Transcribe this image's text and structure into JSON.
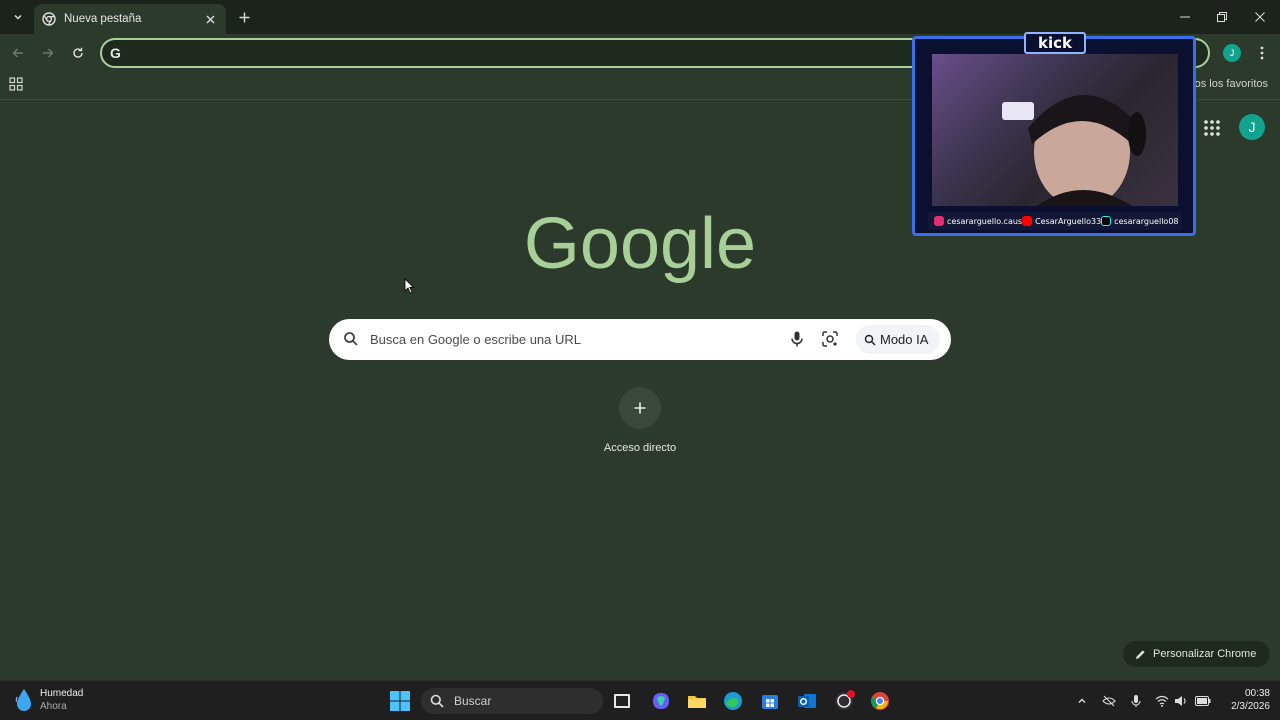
{
  "browser": {
    "tab": {
      "title": "Nueva pestaña"
    },
    "profile_initial": "J",
    "bookmarks": {
      "all_bookmarks_label": "dos los favoritos"
    }
  },
  "ntp": {
    "logo_text": "Google",
    "search_placeholder": "Busca en Google o escribe una URL",
    "ai_mode_label": "Modo IA",
    "shortcut_label": "Acceso directo",
    "customize_label": "Personalizar Chrome",
    "profile_initial": "J"
  },
  "overlay": {
    "brand": "kick",
    "socials": [
      {
        "handle": "cesararguello.caus",
        "color": "#e1306c"
      },
      {
        "handle": "CesarArguello33",
        "color": "#ff0000"
      },
      {
        "handle": "cesararguello08",
        "color": "#25f4ee"
      }
    ]
  },
  "taskbar": {
    "weather_title": "Humedad",
    "weather_sub": "Ahora",
    "search_label": "Buscar",
    "time": "00:38",
    "date": "2/3/2026"
  },
  "colors": {
    "page_bg": "#2c3a2b",
    "logo": "#a9cf98",
    "omnibox_focus": "#a9cf98",
    "avatar": "#11a38e"
  }
}
